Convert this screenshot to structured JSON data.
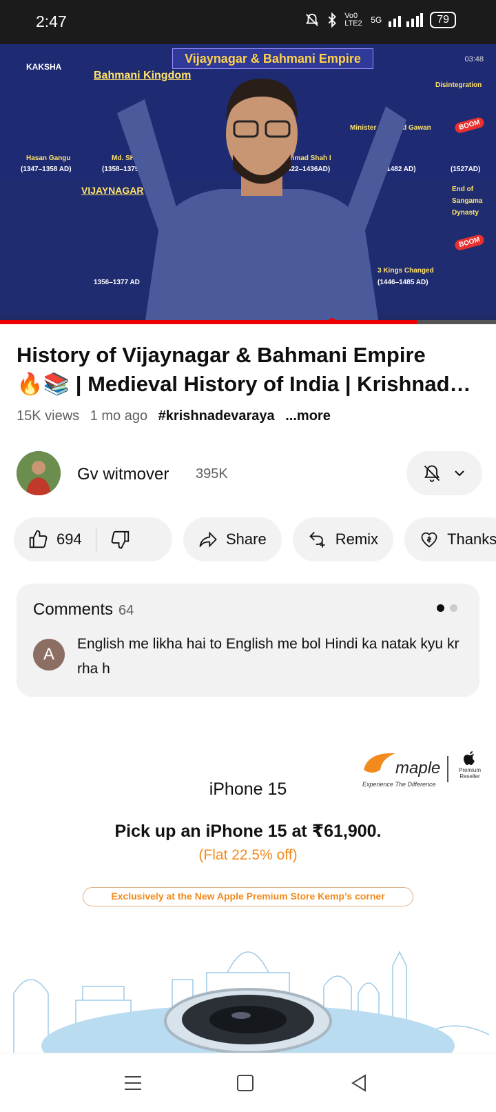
{
  "status_bar": {
    "time": "2:47",
    "network": "Vo0 LTE2",
    "signal": "5G",
    "battery": "79"
  },
  "player": {
    "slide_title": "Vijaynagar & Bahmani Empire",
    "timestamp": "03:48",
    "logo": "KAKSHA",
    "labels": {
      "bahmani": "Bahmani Kingdom",
      "hasan": "Hasan Gangu",
      "hasan_years": "(1347–1358 AD)",
      "md_shah": "Md. SHAH 1",
      "md_shah_years": "(1358–1375 AD)",
      "ahmad": "Ahmad Shah I",
      "ahmad_years": "(1422–1436AD)",
      "gawan": "Minister Mahmud Gawan",
      "gawan_years": "(1436–1482 AD)",
      "disintegration": "Disintegration",
      "disintegration_year": "(1527AD)",
      "vijay": "VIJAYNAGAR",
      "end": "End of Sangama Dynasty",
      "kings": "3 Kings Changed",
      "kings_years": "(1446–1485 AD)",
      "harihara_years": "1356–1377 AD",
      "boom": "BOOM"
    },
    "progress_fraction": 0.84,
    "knob_fraction": 0.67
  },
  "video": {
    "title_line1": "History of Vijaynagar & Bahmani Empire",
    "title_line2": "🔥📚 | Medieval History of India | Krishnadevaraya",
    "views": "15K views",
    "age": "1 mo ago",
    "hashtag": "#krishnadevaraya",
    "more": "...more"
  },
  "channel": {
    "name": "Gv witmover",
    "subscribers": "395K"
  },
  "actions": {
    "likes": "694",
    "share": "Share",
    "remix": "Remix",
    "thanks": "Thanks"
  },
  "comments": {
    "label": "Comments",
    "count": "64",
    "avatar_letter": "A",
    "top_comment": "English me likha hai to English me bol Hindi ka natak kyu kr rha h"
  },
  "ad": {
    "brand": "maple",
    "brand_tagline": "Experience The Difference",
    "partner": "Premium Reseller",
    "product": "iPhone 15",
    "headline": "Pick up an iPhone 15 at ₹61,900.",
    "discount": "(Flat 22.5% off)",
    "store_line": "Exclusively at the New Apple Premium Store Kemp’s corner"
  },
  "colors": {
    "accent_red": "#ff0000",
    "ad_orange": "#f28b1d",
    "chip_bg": "#f2f2f2"
  }
}
